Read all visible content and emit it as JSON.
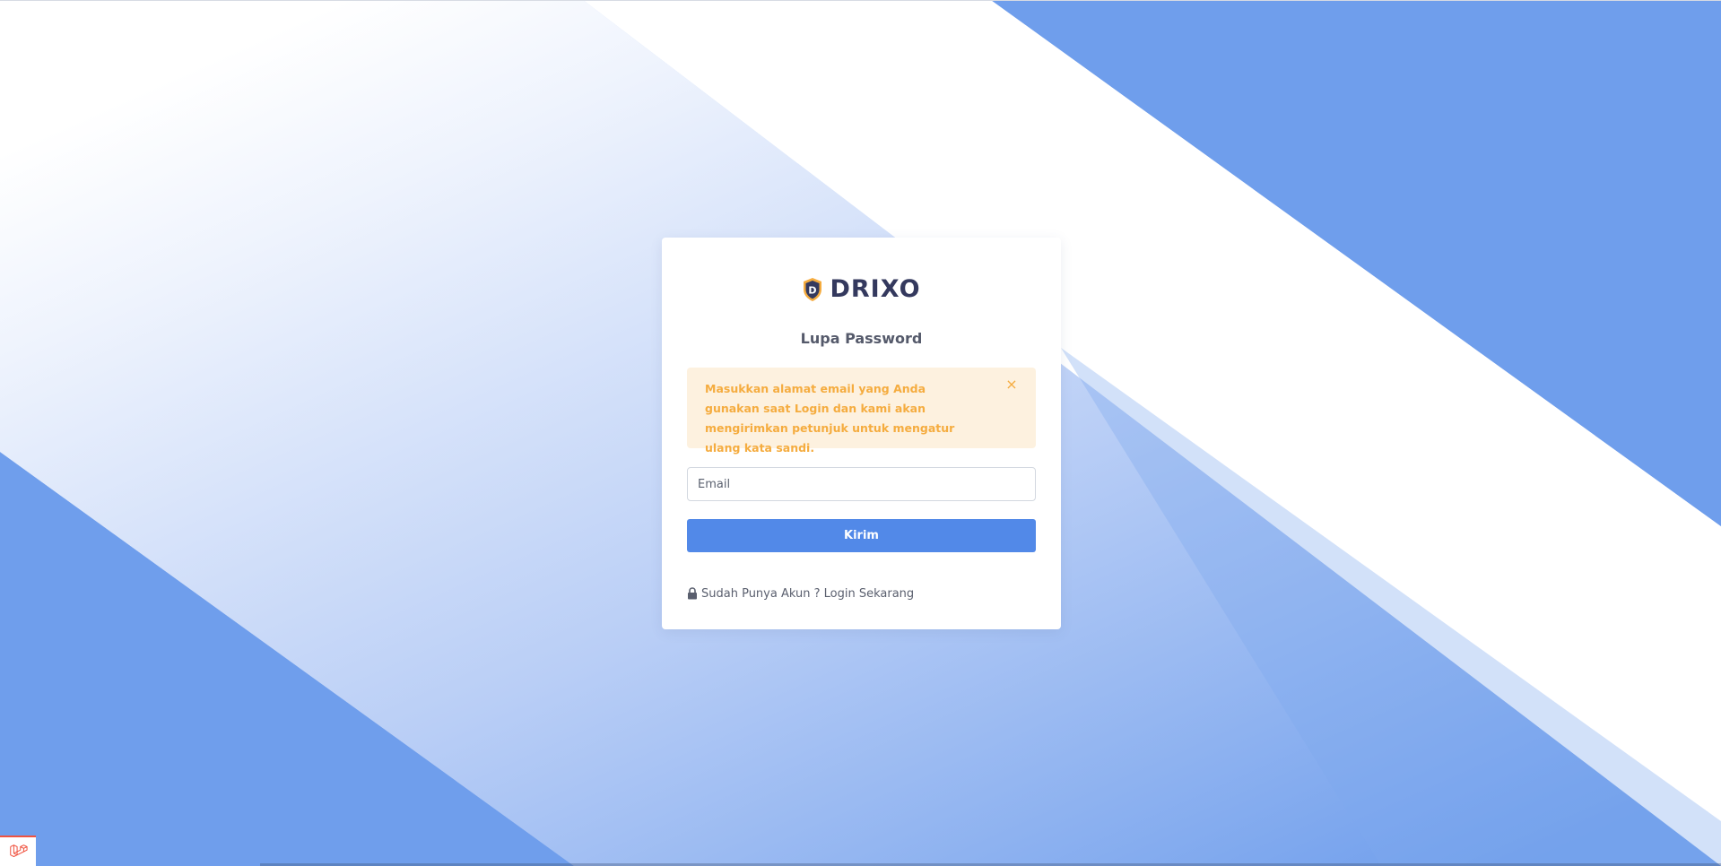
{
  "brand": {
    "name": "DRIXO",
    "logo_letter": "D",
    "primary_color": "#5289e8",
    "logo_shield_color": "#f5ac3f"
  },
  "page": {
    "title": "Lupa Password"
  },
  "alert": {
    "message": "Masukkan alamat email yang Anda gunakan saat Login dan kami akan mengirimkan petunjuk untuk mengatur ulang kata sandi.",
    "close_symbol": "×",
    "text_color": "#f5ac3f",
    "background_color": "#fdf1df"
  },
  "form": {
    "email_placeholder": "Email",
    "email_value": "",
    "submit_label": "Kirim"
  },
  "footer": {
    "login_prompt": "Sudah Punya Akun ? Login Sekarang",
    "lock_icon": "lock-icon"
  },
  "debug_badge": {
    "icon": "laravel-icon"
  },
  "background": {
    "base_blue": "#6f9eec",
    "light": "#ffffff"
  }
}
